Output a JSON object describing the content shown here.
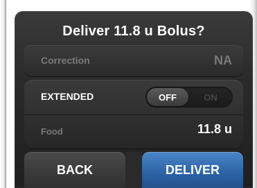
{
  "dialog": {
    "title": "Deliver 11.8 u Bolus?"
  },
  "correction": {
    "label": "Correction",
    "value": "NA"
  },
  "extended": {
    "label": "EXTENDED",
    "toggle_off": "OFF",
    "toggle_on": "ON",
    "state": "OFF"
  },
  "food": {
    "label": "Food",
    "value": "11.8 u"
  },
  "actions": {
    "back_label": "BACK",
    "deliver_label": "DELIVER"
  },
  "colors": {
    "background": "#2a2a2a",
    "deliver_accent": "#2b62a6",
    "muted_text": "#7a7a7a"
  }
}
